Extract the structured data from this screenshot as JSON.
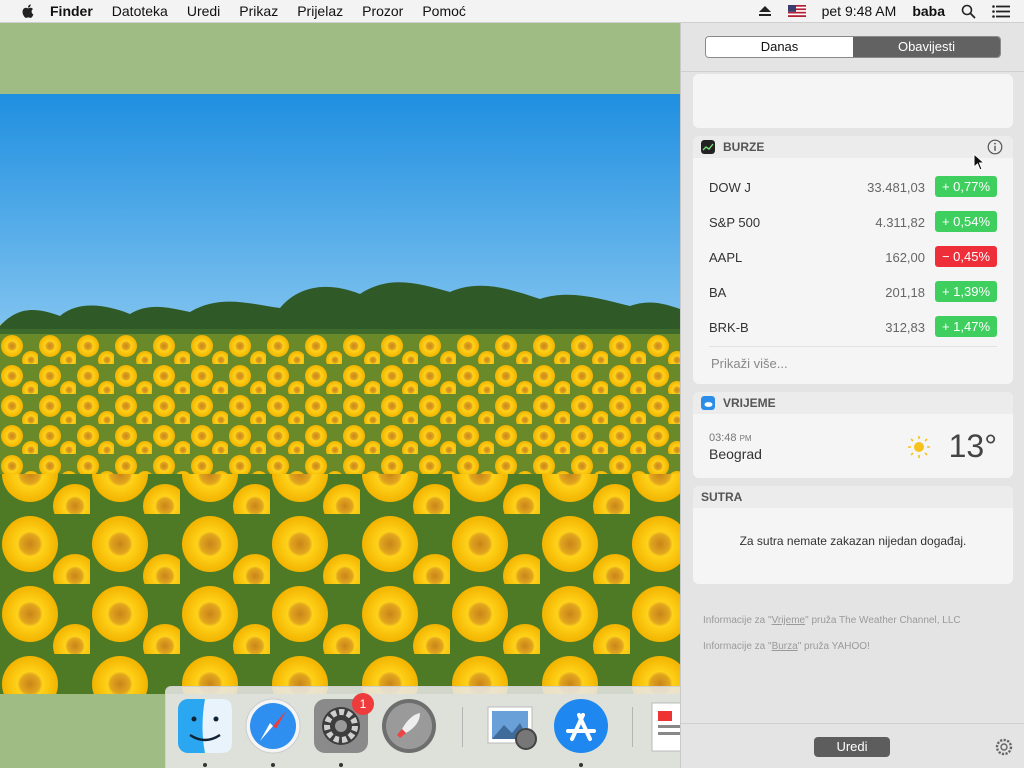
{
  "menubar": {
    "app": "Finder",
    "items": [
      "Datoteka",
      "Uredi",
      "Prikaz",
      "Prijelaz",
      "Prozor",
      "Pomoć"
    ],
    "clock": "pet 9:48 AM",
    "user": "baba"
  },
  "dock": {
    "settings_badge": "1"
  },
  "notification_center": {
    "tabs": {
      "today": "Danas",
      "notifications": "Obavijesti"
    },
    "stocks": {
      "title": "BURZE",
      "rows": [
        {
          "symbol": "DOW J",
          "price": "33.481,03",
          "change": "+ 0,77%",
          "direction": "up"
        },
        {
          "symbol": "S&P 500",
          "price": "4.311,82",
          "change": "+ 0,54%",
          "direction": "up"
        },
        {
          "symbol": "AAPL",
          "price": "162,00",
          "change": "− 0,45%",
          "direction": "down"
        },
        {
          "symbol": "BA",
          "price": "201,18",
          "change": "+ 1,39%",
          "direction": "up"
        },
        {
          "symbol": "BRK-B",
          "price": "312,83",
          "change": "+ 1,47%",
          "direction": "up"
        }
      ],
      "show_more": "Prikaži više..."
    },
    "weather": {
      "title": "VRIJEME",
      "time": "03:48",
      "period": "PM",
      "city": "Beograd",
      "temp": "13°"
    },
    "tomorrow": {
      "title": "SUTRA",
      "message": "Za sutra nemate zakazan nijedan događaj."
    },
    "credits": {
      "weather_prefix": "Informacije za \"",
      "weather_link": "Vrijeme",
      "weather_suffix": "\" pruža The Weather Channel, LLC",
      "stocks_prefix": "Informacije za \"",
      "stocks_link": "Burza",
      "stocks_suffix": "\" pruža YAHOO!"
    },
    "edit_label": "Uredi"
  },
  "colors": {
    "up": "#3fcf5f",
    "down": "#ee2f3a"
  }
}
